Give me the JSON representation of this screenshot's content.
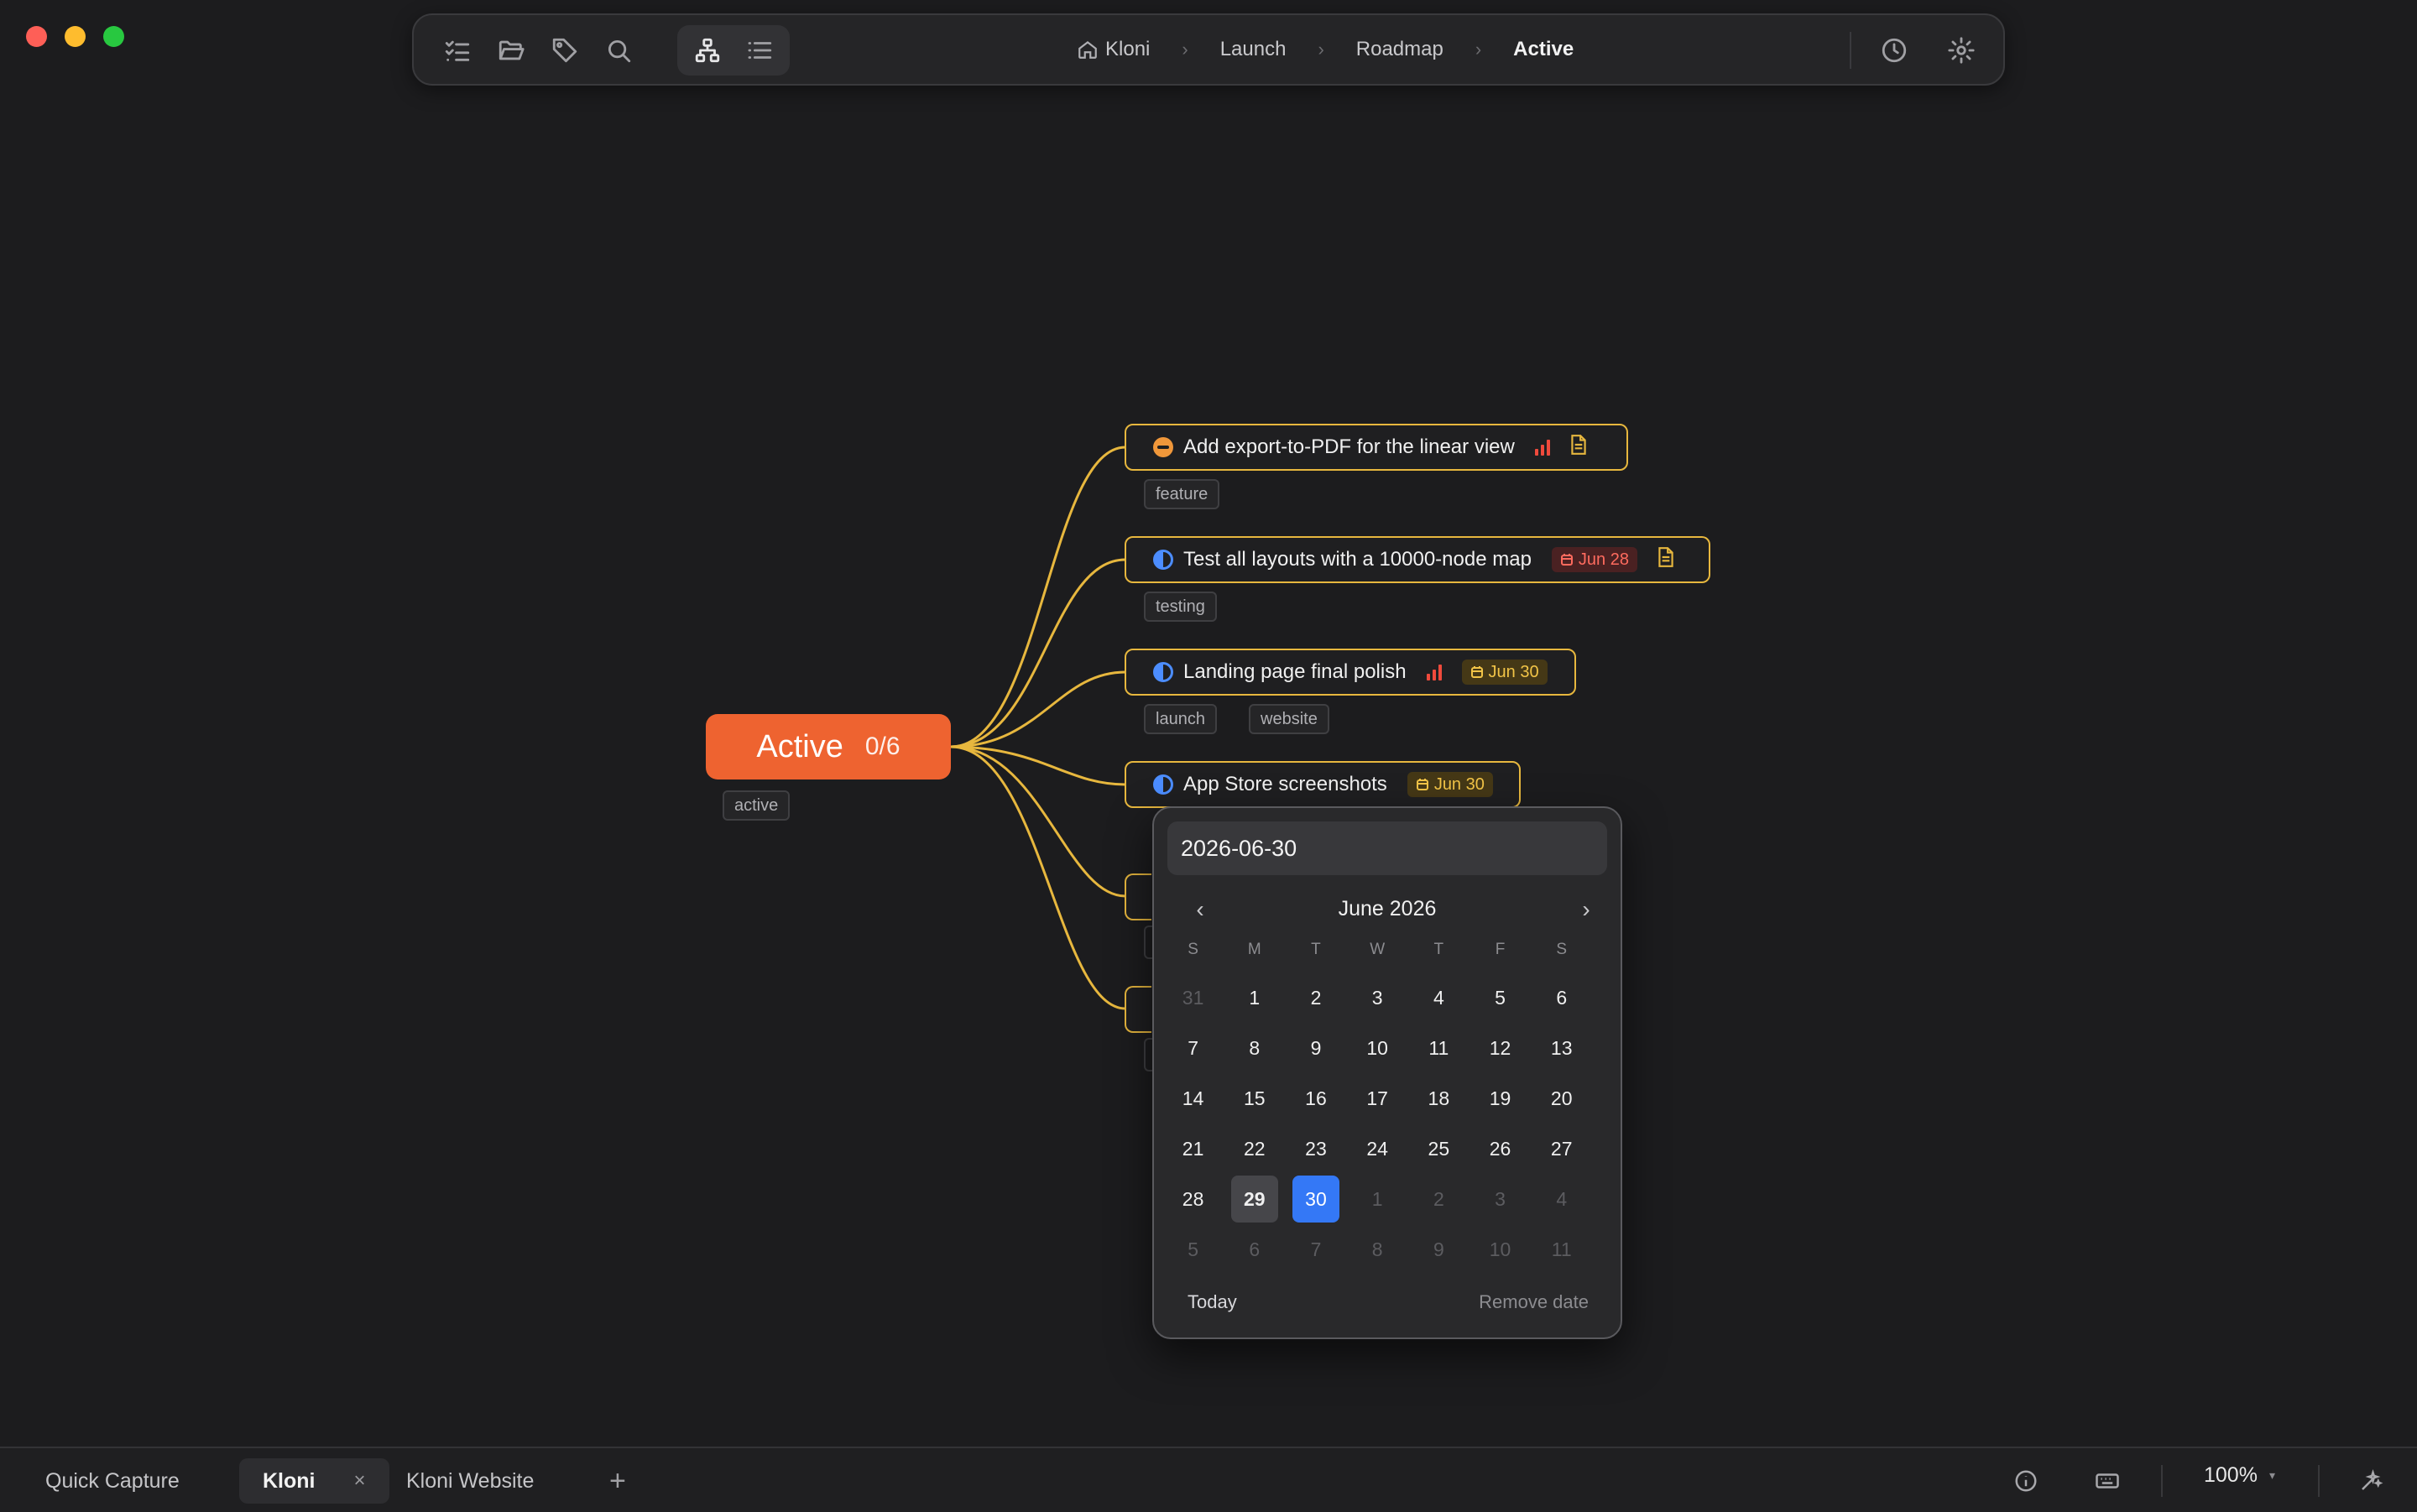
{
  "toolbar": {
    "buttons": [
      "checklist-icon",
      "folder-icon",
      "tag-icon",
      "search-icon",
      "mindmap-icon",
      "list-icon",
      "history-icon",
      "settings-icon"
    ],
    "breadcrumb": [
      "Kloni",
      "Launch",
      "Roadmap",
      "Active"
    ]
  },
  "map": {
    "root": {
      "title": "Active",
      "count": "0/6",
      "tag": "active",
      "color": "#ee6330"
    },
    "nodes": [
      {
        "title": "Add export-to-PDF for the linear view",
        "status": "blocked",
        "priority": "high",
        "has_note": true,
        "tags": [
          "feature"
        ]
      },
      {
        "title": "Test all layouts with a 10000-node map",
        "status": "in-progress",
        "date": "Jun 28",
        "date_style": "overdue",
        "has_note": true,
        "tags": [
          "testing"
        ]
      },
      {
        "title": "Landing page final polish",
        "status": "in-progress",
        "priority": "high",
        "date": "Jun 30",
        "tags": [
          "launch",
          "website"
        ]
      },
      {
        "title": "App Store screenshots",
        "status": "in-progress",
        "date": "Jun 30"
      }
    ],
    "connector_color": "#e7b73e"
  },
  "datepicker": {
    "input_value": "2026-06-30",
    "month_label": "June 2026",
    "prev_icon": "‹",
    "next_icon": "›",
    "weekdays": [
      "S",
      "M",
      "T",
      "W",
      "T",
      "F",
      "S"
    ],
    "weeks": [
      [
        {
          "d": "31",
          "m": true
        },
        {
          "d": "1"
        },
        {
          "d": "2"
        },
        {
          "d": "3"
        },
        {
          "d": "4"
        },
        {
          "d": "5"
        },
        {
          "d": "6"
        }
      ],
      [
        {
          "d": "7"
        },
        {
          "d": "8"
        },
        {
          "d": "9"
        },
        {
          "d": "10"
        },
        {
          "d": "11"
        },
        {
          "d": "12"
        },
        {
          "d": "13"
        }
      ],
      [
        {
          "d": "14"
        },
        {
          "d": "15"
        },
        {
          "d": "16"
        },
        {
          "d": "17"
        },
        {
          "d": "18"
        },
        {
          "d": "19"
        },
        {
          "d": "20"
        }
      ],
      [
        {
          "d": "21"
        },
        {
          "d": "22"
        },
        {
          "d": "23"
        },
        {
          "d": "24"
        },
        {
          "d": "25"
        },
        {
          "d": "26"
        },
        {
          "d": "27"
        }
      ],
      [
        {
          "d": "28"
        },
        {
          "d": "29",
          "today": true
        },
        {
          "d": "30",
          "selected": true
        },
        {
          "d": "1",
          "m": true
        },
        {
          "d": "2",
          "m": true
        },
        {
          "d": "3",
          "m": true
        },
        {
          "d": "4",
          "m": true
        }
      ],
      [
        {
          "d": "5",
          "m": true
        },
        {
          "d": "6",
          "m": true
        },
        {
          "d": "7",
          "m": true
        },
        {
          "d": "8",
          "m": true
        },
        {
          "d": "9",
          "m": true
        },
        {
          "d": "10",
          "m": true
        },
        {
          "d": "11",
          "m": true
        }
      ]
    ],
    "today_label": "Today",
    "remove_label": "Remove date",
    "selected_color": "#3478f6"
  },
  "tabbar": {
    "tabs": [
      {
        "label": "Quick Capture"
      },
      {
        "label": "Kloni",
        "active": true,
        "close": "×"
      },
      {
        "label": "Kloni Website"
      }
    ],
    "add_label": "+",
    "zoom": "100%",
    "zoom_caret": "▾"
  }
}
